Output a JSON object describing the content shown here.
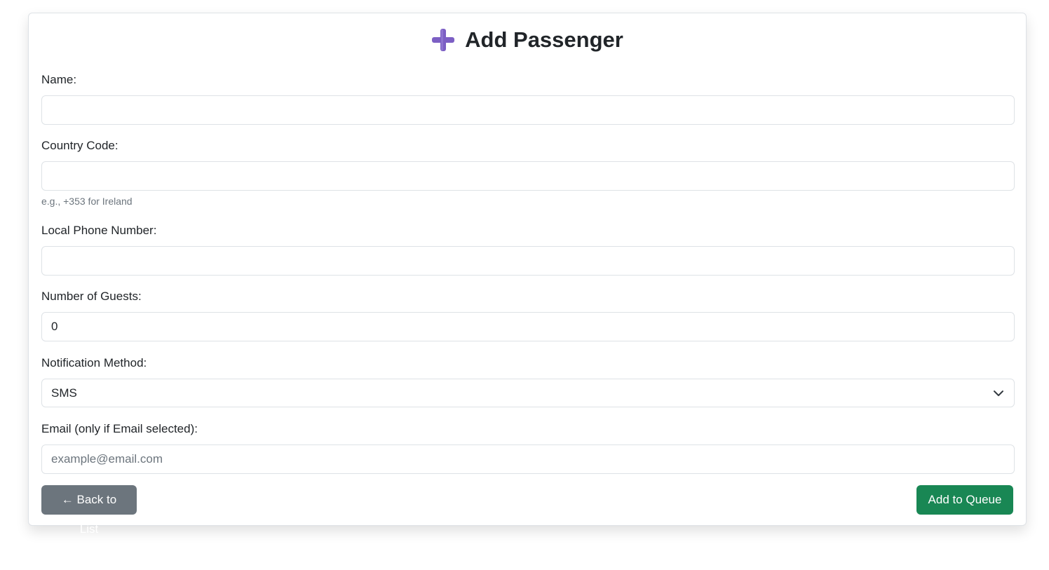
{
  "header": {
    "title": "Add Passenger",
    "icon": "plus-icon",
    "icon_color": "#7c5fc4"
  },
  "form": {
    "name": {
      "label": "Name:",
      "value": "",
      "placeholder": ""
    },
    "country_code": {
      "label": "Country Code:",
      "value": "",
      "placeholder": "",
      "help": "e.g., +353 for Ireland"
    },
    "local_phone": {
      "label": "Local Phone Number:",
      "value": "",
      "placeholder": ""
    },
    "guests": {
      "label": "Number of Guests:",
      "value": "0"
    },
    "notification": {
      "label": "Notification Method:",
      "selected": "SMS"
    },
    "email": {
      "label": "Email (only if Email selected):",
      "value": "",
      "placeholder": "example@email.com"
    }
  },
  "actions": {
    "back_label": "← Back to List",
    "add_label": "Add to Queue"
  },
  "colors": {
    "secondary": "#6c757d",
    "success": "#198754",
    "border": "#dee2e6"
  }
}
